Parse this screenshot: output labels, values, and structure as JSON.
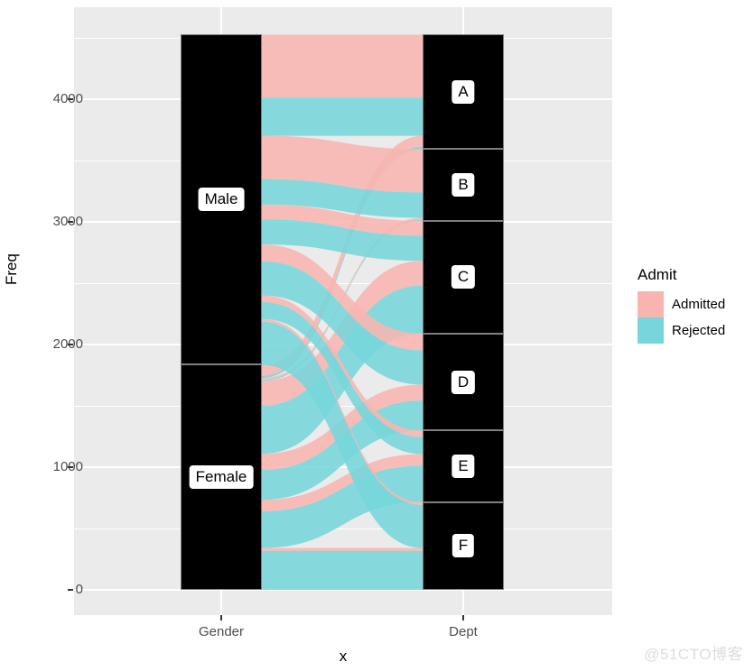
{
  "chart_data": {
    "type": "alluvial",
    "title": "",
    "xlabel": "x",
    "ylabel": "Freq",
    "axes": {
      "x_categories": [
        "Gender",
        "Dept"
      ],
      "y_ticks": [
        "0",
        "1000",
        "2000",
        "3000",
        "4000"
      ],
      "y_tick_values": [
        0,
        1000,
        2000,
        3000,
        4000
      ],
      "y_minor_ticks": [
        500,
        1500,
        2500,
        3500,
        4500
      ],
      "ylim": [
        0,
        4600
      ],
      "grid": true
    },
    "legend": {
      "title": "Admit",
      "position": "right",
      "entries": [
        {
          "label": "Admitted",
          "color": "#F8B5B0"
        },
        {
          "label": "Rejected",
          "color": "#76D6DB"
        }
      ]
    },
    "axis_strata": [
      {
        "axis": "Gender",
        "strata": [
          {
            "label": "Male",
            "value": 2691
          },
          {
            "label": "Female",
            "value": 1835
          }
        ]
      },
      {
        "axis": "Dept",
        "strata": [
          {
            "label": "A",
            "value": 933
          },
          {
            "label": "B",
            "value": 585
          },
          {
            "label": "C",
            "value": 918
          },
          {
            "label": "D",
            "value": 792
          },
          {
            "label": "E",
            "value": 584
          },
          {
            "label": "F",
            "value": 714
          }
        ]
      }
    ],
    "flows": [
      {
        "gender": "Male",
        "dept": "A",
        "admit": "Admitted",
        "value": 512
      },
      {
        "gender": "Male",
        "dept": "A",
        "admit": "Rejected",
        "value": 313
      },
      {
        "gender": "Female",
        "dept": "A",
        "admit": "Admitted",
        "value": 89
      },
      {
        "gender": "Female",
        "dept": "A",
        "admit": "Rejected",
        "value": 19
      },
      {
        "gender": "Male",
        "dept": "B",
        "admit": "Admitted",
        "value": 353
      },
      {
        "gender": "Male",
        "dept": "B",
        "admit": "Rejected",
        "value": 207
      },
      {
        "gender": "Female",
        "dept": "B",
        "admit": "Admitted",
        "value": 17
      },
      {
        "gender": "Female",
        "dept": "B",
        "admit": "Rejected",
        "value": 8
      },
      {
        "gender": "Male",
        "dept": "C",
        "admit": "Admitted",
        "value": 120
      },
      {
        "gender": "Male",
        "dept": "C",
        "admit": "Rejected",
        "value": 205
      },
      {
        "gender": "Female",
        "dept": "C",
        "admit": "Admitted",
        "value": 202
      },
      {
        "gender": "Female",
        "dept": "C",
        "admit": "Rejected",
        "value": 391
      },
      {
        "gender": "Male",
        "dept": "D",
        "admit": "Admitted",
        "value": 138
      },
      {
        "gender": "Male",
        "dept": "D",
        "admit": "Rejected",
        "value": 279
      },
      {
        "gender": "Female",
        "dept": "D",
        "admit": "Admitted",
        "value": 131
      },
      {
        "gender": "Female",
        "dept": "D",
        "admit": "Rejected",
        "value": 244
      },
      {
        "gender": "Male",
        "dept": "E",
        "admit": "Admitted",
        "value": 53
      },
      {
        "gender": "Male",
        "dept": "E",
        "admit": "Rejected",
        "value": 138
      },
      {
        "gender": "Female",
        "dept": "E",
        "admit": "Admitted",
        "value": 94
      },
      {
        "gender": "Female",
        "dept": "E",
        "admit": "Rejected",
        "value": 299
      },
      {
        "gender": "Male",
        "dept": "F",
        "admit": "Admitted",
        "value": 22
      },
      {
        "gender": "Male",
        "dept": "F",
        "admit": "Rejected",
        "value": 351
      },
      {
        "gender": "Female",
        "dept": "F",
        "admit": "Admitted",
        "value": 24
      },
      {
        "gender": "Female",
        "dept": "F",
        "admit": "Rejected",
        "value": 317
      }
    ]
  },
  "watermark": {
    "text": "@51CTO博客"
  },
  "theme": {
    "panel_bg": "#EBEBEB",
    "grid_color": "#FFFFFF",
    "stratum_fill": "#000000",
    "stratum_border": "#7F7F7F",
    "admitted_color": "#F8B5B0",
    "rejected_color": "#76D6DB",
    "text_color": "#4D4D4D",
    "title_color": "#000000"
  }
}
